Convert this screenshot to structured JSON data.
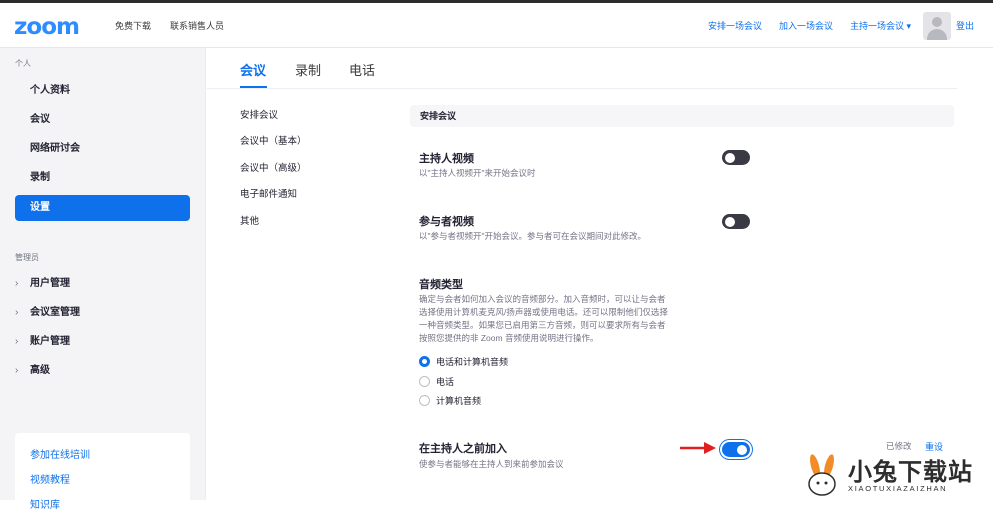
{
  "header": {
    "logo": "zoom",
    "links": [
      "免费下载",
      "联系销售人员"
    ],
    "right_links": [
      "安排一场会议",
      "加入一场会议",
      "主持一场会议 ▾",
      "登出"
    ]
  },
  "sidebar": {
    "personal_title": "个人",
    "personal_items": [
      "个人资料",
      "会议",
      "网络研讨会",
      "录制",
      "设置"
    ],
    "admin_title": "管理员",
    "admin_items": [
      "用户管理",
      "会议室管理",
      "账户管理",
      "高级"
    ],
    "help_links": [
      "参加在线培训",
      "视频教程",
      "知识库"
    ]
  },
  "main": {
    "tabs": [
      "会议",
      "录制",
      "电话"
    ],
    "subnav": [
      "安排会议",
      "会议中（基本）",
      "会议中（高级）",
      "电子邮件通知",
      "其他"
    ],
    "group_title": "安排会议",
    "settings": {
      "host_video": {
        "title": "主持人视频",
        "desc": "以\"主持人视频开\"来开始会议时",
        "enabled": false
      },
      "participant_video": {
        "title": "参与者视频",
        "desc": "以\"参与者视频开\"开始会议。参与者可在会议期间对此修改。",
        "enabled": false
      },
      "audio_type": {
        "title": "音频类型",
        "desc": [
          "确定与会者如何加入会议的音频部分。加入音频时，可以让与会者",
          "选择使用计算机麦克风/扬声器或使用电话。还可以限制他们仅选择",
          "一种音频类型。如果您已启用第三方音频，则可以要求所有与会者",
          "按照您提供的非 Zoom 音频使用说明进行操作。"
        ],
        "options": [
          "电话和计算机音频",
          "电话",
          "计算机音频"
        ],
        "selected": "电话和计算机音频"
      },
      "join_before_host": {
        "title": "在主持人之前加入",
        "desc": "使参与者能够在主持人到来前参加会议",
        "enabled": true,
        "modified_label": "已修改",
        "reset_label": "重设"
      }
    }
  },
  "watermark": {
    "title": "小兔下载站",
    "subtitle": "XIAOTUXIAZAIZHAN"
  },
  "colors": {
    "accent": "#0e71eb",
    "logo": "#2d8cff",
    "annotation_arrow": "#e02020"
  }
}
